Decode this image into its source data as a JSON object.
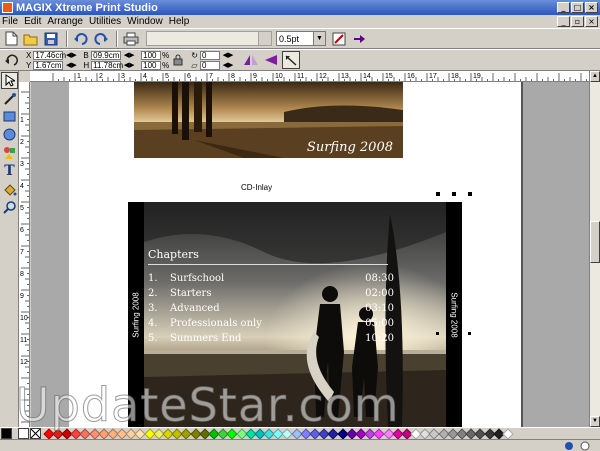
{
  "window": {
    "title": "MAGIX Xtreme Print Studio"
  },
  "menu": [
    "File",
    "Edit",
    "Arrange",
    "Utilities",
    "Window",
    "Help"
  ],
  "toolbar": {
    "line_width": "0.5pt"
  },
  "props": {
    "x": "17.46cm",
    "y": "1.67cm",
    "b": "09.9cm",
    "h": "11.78cm",
    "scale_x": "100",
    "scale_y": "100",
    "pct": "%",
    "rot": "0",
    "skew": "0"
  },
  "ruler_h": [
    "1",
    "2",
    "3",
    "4",
    "5",
    "6",
    "7",
    "8",
    "9",
    "10",
    "11",
    "12",
    "13",
    "14",
    "15",
    "16",
    "17",
    "18",
    "19"
  ],
  "ruler_v": [
    "1",
    "2",
    "3",
    "4",
    "5",
    "6",
    "7",
    "8",
    "9",
    "10",
    "11",
    "12"
  ],
  "document": {
    "banner_text": "Surfing 2008",
    "inlay_label": "CD-Inlay",
    "spine_left": "Surfing 2008",
    "spine_right": "Surfing 2008",
    "chapters_title": "Chapters",
    "chapters": [
      {
        "num": "1.",
        "name": "Surfschool",
        "time": "08:30"
      },
      {
        "num": "2.",
        "name": "Starters",
        "time": "02:00"
      },
      {
        "num": "3.",
        "name": "Advanced",
        "time": "03:10"
      },
      {
        "num": "4.",
        "name": "Professionals only",
        "time": "05:00"
      },
      {
        "num": "5.",
        "name": "Summers End",
        "time": "10:20"
      }
    ]
  },
  "palette": [
    "#ff0000",
    "#e21b1b",
    "#c80000",
    "#ff4040",
    "#ff7060",
    "#ff9070",
    "#ffa070",
    "#ffb080",
    "#ffc090",
    "#ffd0a0",
    "#ffe0b0",
    "#ffff00",
    "#f0f060",
    "#d8d800",
    "#c0c000",
    "#a0a000",
    "#808000",
    "#607000",
    "#00c000",
    "#40d040",
    "#00ff00",
    "#80ff80",
    "#00e0a0",
    "#00c0c0",
    "#40e0e0",
    "#80ffff",
    "#c0ffff",
    "#a0c0ff",
    "#8080ff",
    "#6060e0",
    "#4040c0",
    "#2020a0",
    "#000080",
    "#6000a0",
    "#a000c0",
    "#c040e0",
    "#ff40ff",
    "#ff80ff",
    "#e000a0",
    "#c00080",
    "#ffffff",
    "#e0e0e0",
    "#c8c8c8",
    "#b0b0b0",
    "#989898",
    "#808080",
    "#686868",
    "#505050",
    "#383838",
    "#202020",
    "#ffffff"
  ],
  "watermark": "UpdateStar.com"
}
